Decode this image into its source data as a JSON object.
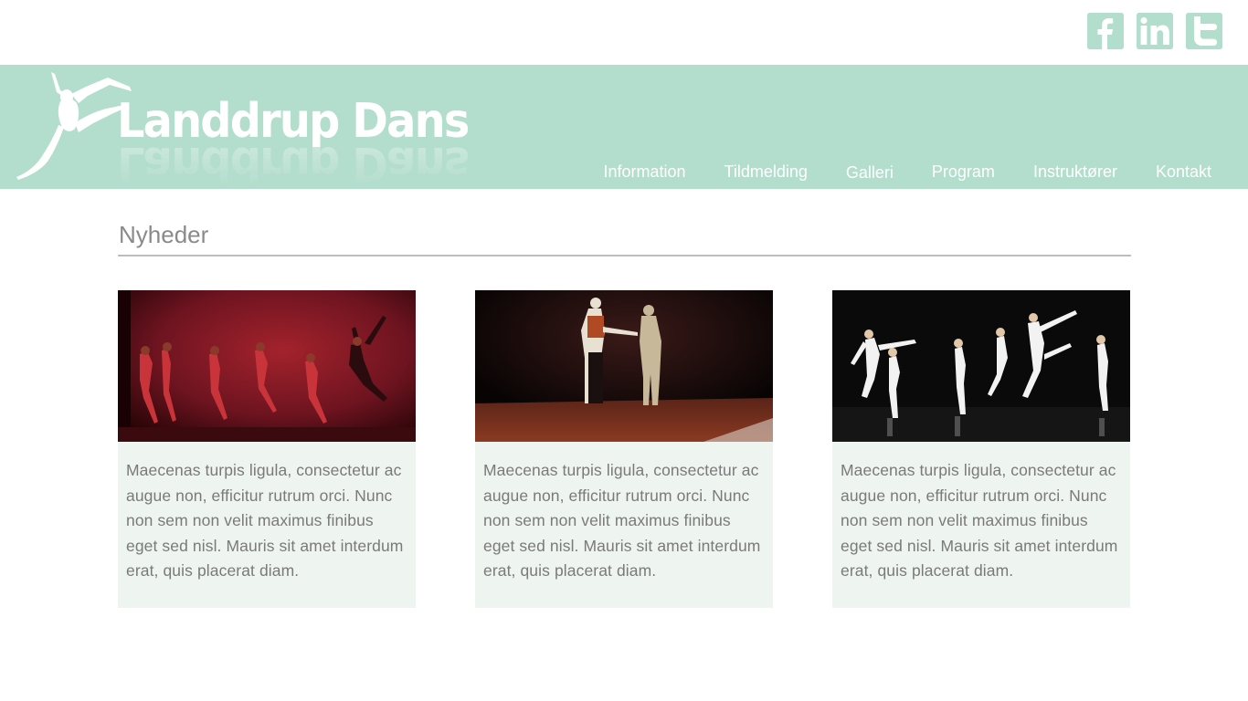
{
  "social": [
    {
      "name": "facebook-icon"
    },
    {
      "name": "linkedin-icon"
    },
    {
      "name": "twitter-icon"
    }
  ],
  "brand": {
    "name": "Landdrup Dans"
  },
  "nav": [
    {
      "label": "Information"
    },
    {
      "label": "Tildmelding"
    },
    {
      "label": "Galleri"
    },
    {
      "label": "Program"
    },
    {
      "label": "Instruktører"
    },
    {
      "label": "Kontakt"
    }
  ],
  "news": {
    "title": "Nyheder",
    "cards": [
      {
        "image": "dance-troupe-red-stage",
        "text": "Maecenas turpis ligula, consectetur ac augue non, efficitur rutrum orci. Nunc non sem non velit maximus finibus eget sed nisl. Mauris sit amet interdum erat, quis placerat diam."
      },
      {
        "image": "couple-dancing-stage",
        "text": "Maecenas turpis ligula, consectetur ac augue non, efficitur rutrum orci. Nunc non sem non velit maximus finibus eget sed nisl. Mauris sit amet interdum erat, quis placerat diam."
      },
      {
        "image": "dancers-white-dresses",
        "text": "Maecenas turpis ligula, consectetur ac augue non, efficitur rutrum orci. Nunc non sem non velit maximus finibus eget sed nisl. Mauris sit amet interdum erat, quis placerat diam."
      }
    ]
  },
  "colors": {
    "accent": "#b3ddcc",
    "card_bg": "#eef4f0",
    "text": "#7a7a7a"
  }
}
